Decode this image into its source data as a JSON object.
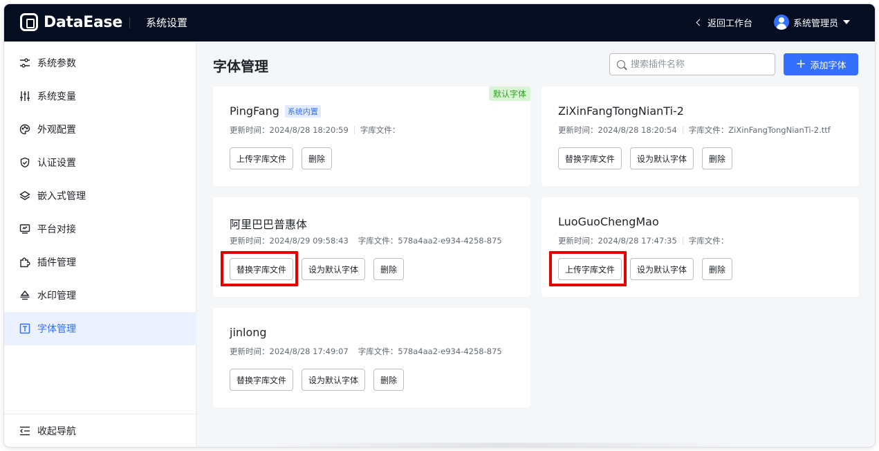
{
  "header": {
    "logo_text": "DataEase",
    "title": "系统设置",
    "back_label": "返回工作台",
    "user_name": "系统管理员"
  },
  "sidebar": {
    "items": [
      {
        "label": "系统参数",
        "icon": "sliders-icon"
      },
      {
        "label": "系统变量",
        "icon": "variable-icon"
      },
      {
        "label": "外观配置",
        "icon": "palette-icon"
      },
      {
        "label": "认证设置",
        "icon": "shield-icon"
      },
      {
        "label": "嵌入式管理",
        "icon": "layers-icon"
      },
      {
        "label": "平台对接",
        "icon": "monitor-icon"
      },
      {
        "label": "插件管理",
        "icon": "plugin-icon"
      },
      {
        "label": "水印管理",
        "icon": "watermark-icon"
      },
      {
        "label": "字体管理",
        "icon": "font-icon",
        "active": true
      }
    ],
    "collapse_label": "收起导航"
  },
  "main": {
    "title": "字体管理",
    "search_placeholder": "搜索插件名称",
    "add_button": "添加字体"
  },
  "labels": {
    "update_time": "更新时间：",
    "font_file": "字库文件："
  },
  "fonts": [
    {
      "name": "PingFang",
      "builtin_tag": "系统内置",
      "default_tag": "默认字体",
      "update_time": "2024/8/28 18:20:59",
      "file": "",
      "buttons": [
        "上传字库文件",
        "删除"
      ]
    },
    {
      "name": "ZiXinFangTongNianTi-2",
      "update_time": "2024/8/28 18:20:54",
      "file": "ZiXinFangTongNianTi-2.ttf",
      "buttons": [
        "替换字库文件",
        "设为默认字体",
        "删除"
      ]
    },
    {
      "name": "阿里巴巴普惠体",
      "update_time": "2024/8/29 09:58:43",
      "file": "578a4aa2-e934-4258-875",
      "buttons": [
        "替换字库文件",
        "设为默认字体",
        "删除"
      ]
    },
    {
      "name": "LuoGuoChengMao",
      "update_time": "2024/8/28 17:47:35",
      "file": "",
      "buttons": [
        "上传字库文件",
        "设为默认字体",
        "删除"
      ]
    },
    {
      "name": "jinlong",
      "update_time": "2024/8/28 17:49:07",
      "file": "578a4aa2-e934-4258-875",
      "buttons": [
        "替换字库文件",
        "设为默认字体",
        "删除"
      ]
    }
  ],
  "colors": {
    "header_bg": "#050e21",
    "accent": "#3370ff",
    "highlight_box": "#e50000",
    "default_tag_green": "#2ea121"
  }
}
